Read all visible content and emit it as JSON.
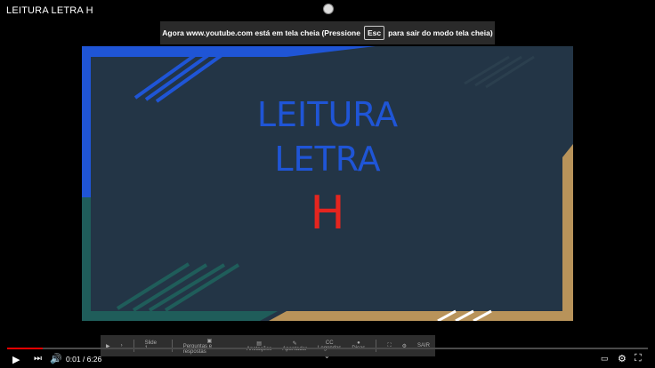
{
  "window": {
    "title": "LEITURA LETRA H"
  },
  "banner": {
    "before": "Agora www.youtube.com está em tela cheia (Pressione",
    "key": "Esc",
    "after": "para sair do modo tela cheia)"
  },
  "slide": {
    "line1": "LEITURA",
    "line2": "LETRA",
    "line3": "H",
    "colors": {
      "blue": "#1f55d6",
      "red": "#e5251f",
      "teal": "#1f5d5a",
      "gold": "#b8935a"
    }
  },
  "player": {
    "time": "0:01 / 6:26",
    "progress": 0.003
  },
  "dock": {
    "slide_label": "Slide 1",
    "questions": "Perguntas e respostas",
    "notes": "Anotações",
    "pointer": "Apontador",
    "captions": "Legendas",
    "help": "Dicas",
    "exit": "SAIR"
  }
}
